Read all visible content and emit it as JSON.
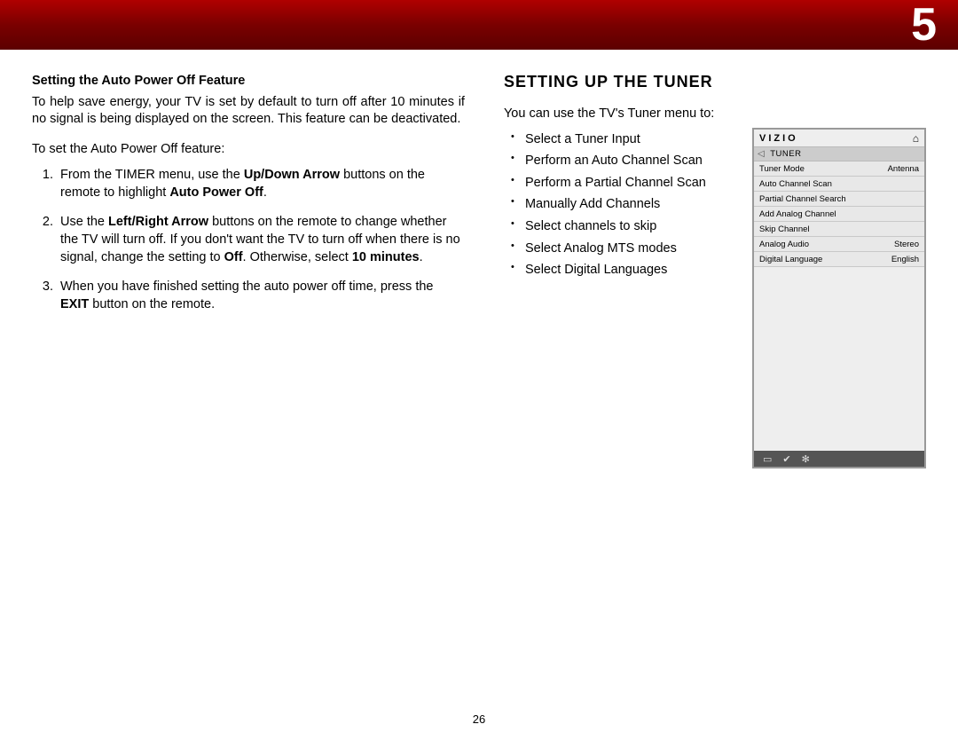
{
  "chapter": "5",
  "page_number": "26",
  "left": {
    "subhead": "Setting the Auto Power Off Feature",
    "intro": "To help save energy, your TV is set by default to turn off after 10 minutes if no signal is being displayed on the screen. This feature can be deactivated.",
    "lead": "To set the Auto Power Off feature:",
    "step1_a": "From the TIMER menu, use the ",
    "step1_b": "Up/Down Arrow",
    "step1_c": " buttons on the remote to highlight ",
    "step1_d": "Auto Power Off",
    "step1_e": ".",
    "step2_a": "Use the ",
    "step2_b": "Left/Right Arrow",
    "step2_c": "  buttons on the remote to change whether the TV will turn off.  If you don't want the TV to turn off when there is no signal, change the setting to ",
    "step2_d": "Off",
    "step2_e": ". Otherwise, select ",
    "step2_f": "10 minutes",
    "step2_g": ".",
    "step3_a": "When you have finished setting the auto power off time, press the ",
    "step3_b": "EXIT",
    "step3_c": " button on the remote."
  },
  "right": {
    "title": "SETTING UP THE TUNER",
    "intro": "You can use the TV's Tuner menu to:",
    "bullets": [
      "Select a Tuner Input",
      "Perform an Auto Channel Scan",
      "Perform a Partial Channel Scan",
      "Manually Add Channels",
      "Select channels to skip",
      "Select Analog MTS modes",
      "Select Digital Languages"
    ]
  },
  "osd": {
    "logo": "VIZIO",
    "title": "TUNER",
    "rows": [
      {
        "label": "Tuner Mode",
        "value": "Antenna"
      },
      {
        "label": "Auto Channel Scan",
        "value": ""
      },
      {
        "label": "Partial Channel Search",
        "value": ""
      },
      {
        "label": "Add Analog Channel",
        "value": ""
      },
      {
        "label": "Skip Channel",
        "value": ""
      },
      {
        "label": "Analog Audio",
        "value": "Stereo"
      },
      {
        "label": "Digital Language",
        "value": "English"
      }
    ]
  }
}
